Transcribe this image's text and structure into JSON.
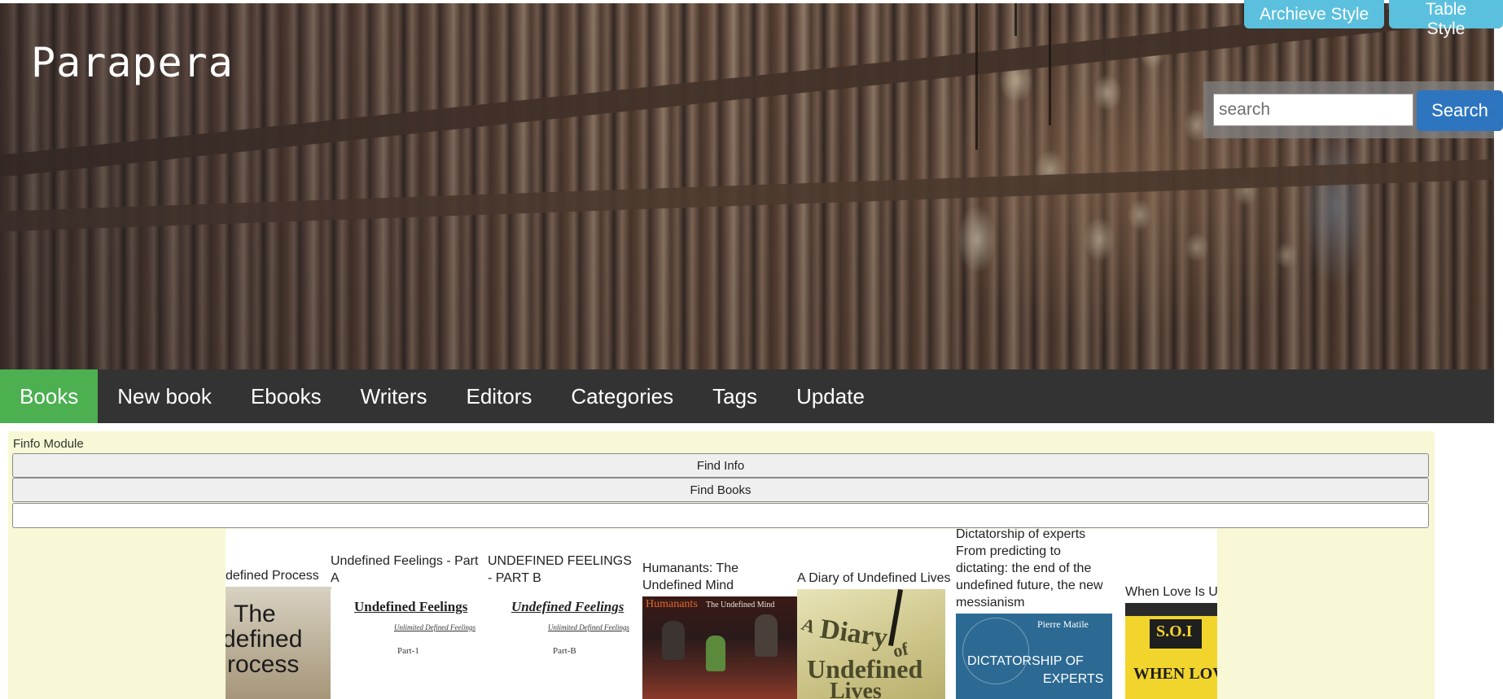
{
  "site": {
    "title": "Parapera"
  },
  "style_buttons": {
    "archive": "Archieve Style",
    "table": "Table Style"
  },
  "search": {
    "placeholder": "search",
    "button": "Search"
  },
  "nav": {
    "items": [
      {
        "label": "Books",
        "active": true
      },
      {
        "label": "New book",
        "active": false
      },
      {
        "label": "Ebooks",
        "active": false
      },
      {
        "label": "Writers",
        "active": false
      },
      {
        "label": "Editors",
        "active": false
      },
      {
        "label": "Categories",
        "active": false
      },
      {
        "label": "Tags",
        "active": false
      },
      {
        "label": "Update",
        "active": false
      }
    ]
  },
  "module": {
    "label": "Finfo Module",
    "find_info": "Find Info",
    "find_books": "Find Books",
    "input_value": ""
  },
  "books": [
    {
      "title": "defined Process",
      "cover_text": [
        "The",
        "defined",
        "rocess"
      ]
    },
    {
      "title": "Undefined Feelings - Part A",
      "cover_text": [
        "Undefined Feelings",
        "Unlimited Defined Feelings",
        "Part-1"
      ]
    },
    {
      "title": "UNDEFINED FEELINGS - PART B",
      "cover_text": [
        "Undefined Feelings",
        "Unlimited Defined Feelings",
        "Part-B"
      ]
    },
    {
      "title": "Humanants: The Undefined Mind",
      "cover_text": [
        "Humanants",
        "The Undefined Mind"
      ]
    },
    {
      "title": "A Diary of Undefined Lives",
      "cover_text": [
        "A",
        "Diary",
        "of",
        "Undefined",
        "Lives"
      ]
    },
    {
      "title": "Dictatorship of experts From predicting to dictating: the end of the undefined future, the new messianism",
      "cover_text": [
        "Pierre Matile",
        "DICTATORSHIP OF",
        "EXPERTS"
      ]
    },
    {
      "title": "When Love Is Un",
      "cover_text": [
        "S.O.I",
        "WHEN LOVE IS UND"
      ]
    }
  ],
  "colors": {
    "nav_bg": "#333333",
    "nav_active": "#4caf50",
    "style_btn": "#5bc0de",
    "search_btn": "#2e75c0",
    "module_bg": "#f8f8d6"
  }
}
